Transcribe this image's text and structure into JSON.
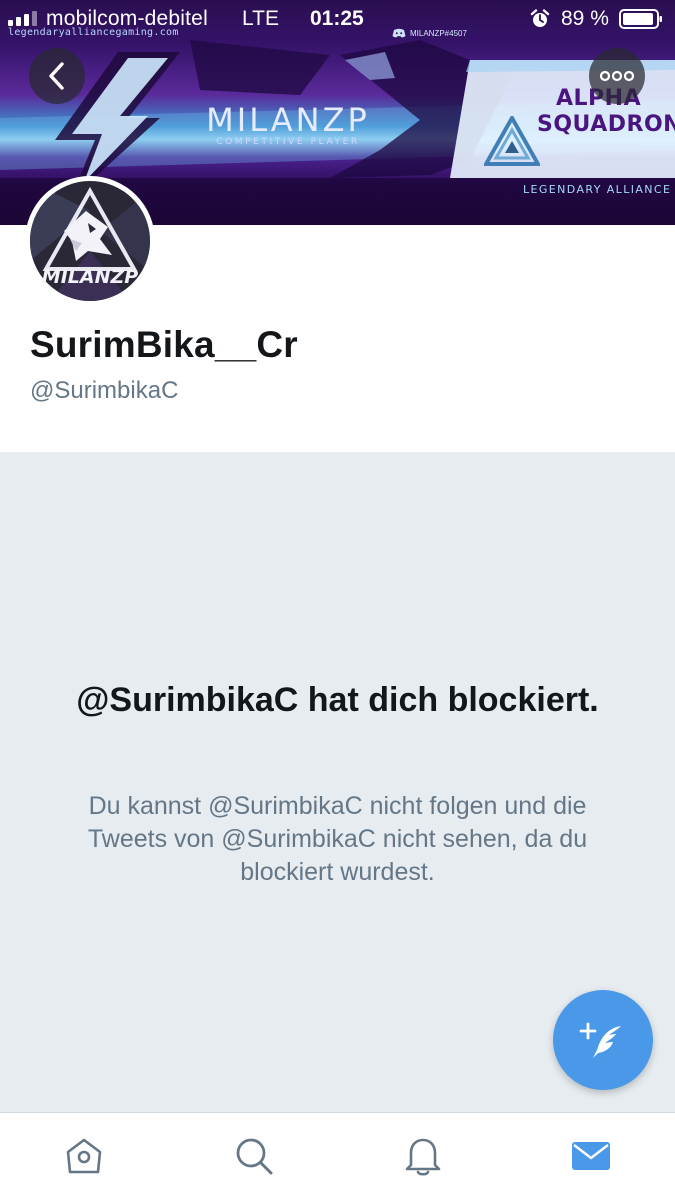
{
  "status_bar": {
    "carrier": "mobilcom-debitel",
    "network": "LTE",
    "time": "01:25",
    "battery_percent": "89 %"
  },
  "banner": {
    "website": "legendaryalliancegaming.com",
    "discord_tag": "MILANZP#4507",
    "title": "MILANZP",
    "subtitle": "COMPETITIVE PLAYER",
    "team_line_1": "ALPHA",
    "team_line_2": "SQUADRON",
    "alliance": "LEGENDARY ALLIANCE"
  },
  "avatar": {
    "text": "MILANZP"
  },
  "profile": {
    "display_name": "SurimBika__Cr",
    "handle": "@SurimbikaC"
  },
  "blocked": {
    "title": "@SurimbikaC hat dich blockiert.",
    "description": "Du kannst @SurimbikaC nicht folgen und die Tweets von @SurimbikaC nicht sehen, da du blockiert wurdest."
  },
  "tabs": [
    {
      "name": "home",
      "icon": "home-icon",
      "active": false
    },
    {
      "name": "search",
      "icon": "search-icon",
      "active": false
    },
    {
      "name": "notifications",
      "icon": "bell-icon",
      "active": false
    },
    {
      "name": "messages",
      "icon": "envelope-icon",
      "active": true
    }
  ],
  "colors": {
    "accent": "#4a99e9",
    "panel_background": "#e6ecf0",
    "secondary_text": "#657786",
    "primary_text": "#14171a"
  }
}
